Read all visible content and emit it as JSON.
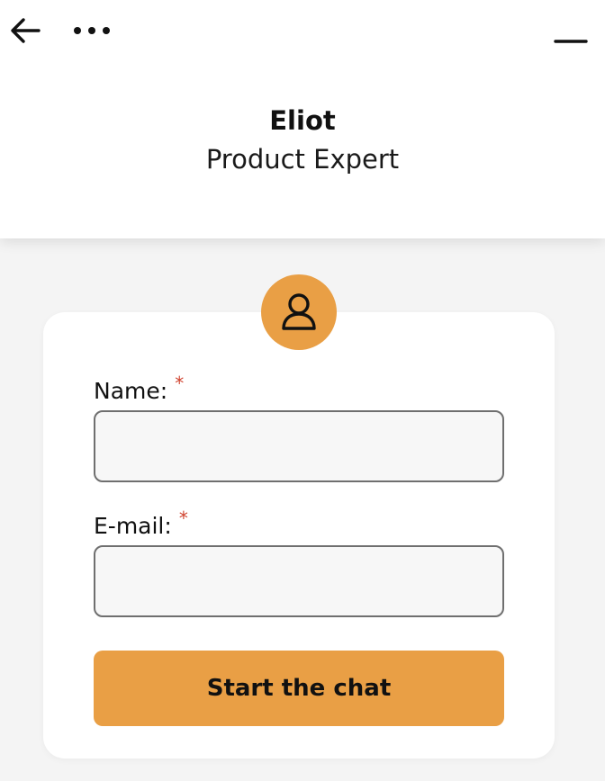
{
  "header": {
    "back_icon": "arrow-left-icon",
    "menu_icon": "more-horizontal-icon",
    "minimize_icon": "minimize-icon",
    "agent_name": "Eliot",
    "agent_role": "Product Expert"
  },
  "form": {
    "avatar_icon": "user-icon",
    "name_label": "Name:",
    "email_label": "E-mail:",
    "required_marker": "*",
    "name_value": "",
    "email_value": "",
    "submit_label": "Start the chat"
  },
  "colors": {
    "accent": "#e99f45",
    "required": "#d0432f",
    "background": "#f4f4f4",
    "card": "#ffffff"
  }
}
